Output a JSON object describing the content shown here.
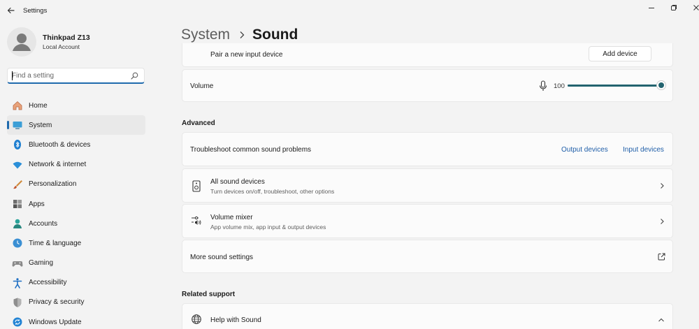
{
  "window": {
    "title": "Settings"
  },
  "user": {
    "name": "Thinkpad Z13",
    "account_type": "Local Account"
  },
  "search": {
    "placeholder": "Find a setting",
    "value": ""
  },
  "nav": [
    {
      "label": "Home",
      "icon": "home-icon"
    },
    {
      "label": "System",
      "icon": "system-icon",
      "active": true
    },
    {
      "label": "Bluetooth & devices",
      "icon": "bluetooth-icon"
    },
    {
      "label": "Network & internet",
      "icon": "wifi-icon"
    },
    {
      "label": "Personalization",
      "icon": "brush-icon"
    },
    {
      "label": "Apps",
      "icon": "apps-icon"
    },
    {
      "label": "Accounts",
      "icon": "accounts-icon"
    },
    {
      "label": "Time & language",
      "icon": "globe-clock-icon"
    },
    {
      "label": "Gaming",
      "icon": "gamepad-icon"
    },
    {
      "label": "Accessibility",
      "icon": "accessibility-icon"
    },
    {
      "label": "Privacy & security",
      "icon": "shield-icon"
    },
    {
      "label": "Windows Update",
      "icon": "update-icon"
    }
  ],
  "breadcrumb": {
    "parent": "System",
    "current": "Sound"
  },
  "pair_input": {
    "label": "Pair a new input device",
    "button": "Add device"
  },
  "volume": {
    "label": "Volume",
    "value": "100",
    "level": 1.0,
    "icon": "microphone-icon"
  },
  "sections": {
    "advanced": "Advanced",
    "related": "Related support"
  },
  "troubleshoot": {
    "label": "Troubleshoot common sound problems",
    "link_output": "Output devices",
    "link_input": "Input devices"
  },
  "all_devices": {
    "title": "All sound devices",
    "subtitle": "Turn devices on/off, troubleshoot, other options",
    "icon": "speaker-device-icon"
  },
  "mixer": {
    "title": "Volume mixer",
    "subtitle": "App volume mix, app input & output devices",
    "icon": "mixer-icon"
  },
  "more_settings": {
    "label": "More sound settings",
    "icon": "open-external-icon"
  },
  "help": {
    "label": "Help with Sound",
    "icon": "globe-icon"
  },
  "colors": {
    "accent": "#1f6aad",
    "slider": "#23636f",
    "link": "#1f5ea8"
  }
}
